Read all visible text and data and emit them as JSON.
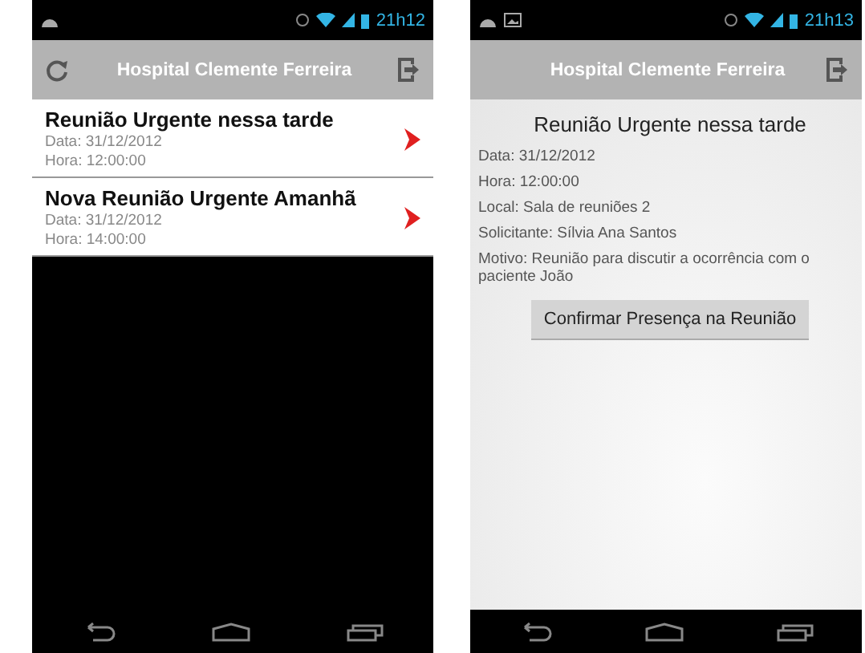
{
  "screens": [
    {
      "kind": "list",
      "status_bar": {
        "time": "21h12",
        "picture_notification": false
      },
      "action_bar": {
        "title": "Hospital Clemente Ferreira",
        "refresh": true
      },
      "meetings": [
        {
          "title": "Reunião Urgente nessa tarde",
          "date": "Data: 31/12/2012",
          "time": "Hora: 12:00:00"
        },
        {
          "title": "Nova Reunião Urgente Amanhã",
          "date": "Data: 31/12/2012",
          "time": "Hora: 14:00:00"
        }
      ]
    },
    {
      "kind": "detail",
      "status_bar": {
        "time": "21h13",
        "picture_notification": true
      },
      "action_bar": {
        "title": "Hospital Clemente Ferreira",
        "refresh": false
      },
      "detail": {
        "title": "Reunião Urgente nessa tarde",
        "lines": [
          "Data: 31/12/2012",
          "Hora: 12:00:00",
          "Local: Sala de reuniões 2",
          "Solicitante: Sílvia Ana Santos",
          "Motivo: Reunião para discutir a ocorrência com o paciente João"
        ],
        "button": "Confirmar Presença na Reunião"
      }
    }
  ]
}
